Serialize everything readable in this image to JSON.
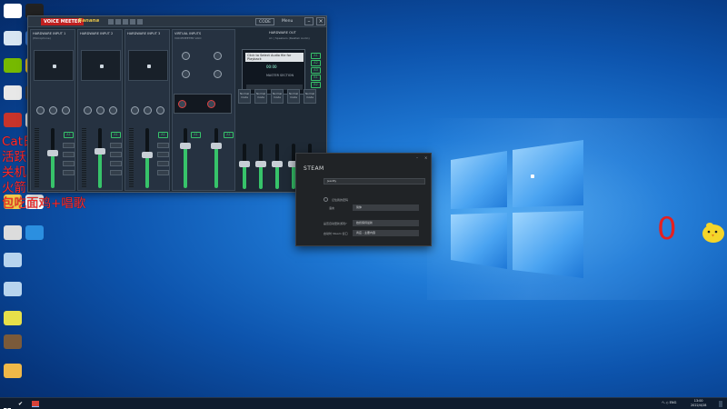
{
  "overlay": {
    "lines": [
      "Cat日常任务",
      "活跃0/66",
      "关机0/3",
      "火箭汽车0/1",
      "包吃面鸡+唱歌"
    ]
  },
  "counter": "0",
  "voicemeeter": {
    "brand": "VOICE MEETER",
    "edition": "Banana",
    "menu_button": "Menu",
    "record_button": "CODE",
    "strips": [
      {
        "title": "HARDWARE INPUT 1",
        "device": "(Microphone)",
        "label": "Fader Gain"
      },
      {
        "title": "HARDWARE INPUT 2",
        "device": "",
        "label": "Fader Gain"
      },
      {
        "title": "HARDWARE INPUT 3",
        "device": "",
        "label": "Fader Gain"
      },
      {
        "title": "VIRTUAL INPUTS",
        "device": "VOICEMEETER VAIO",
        "label": "Fader Gain"
      },
      {
        "title": "",
        "device": "VOICEMEETER AUX",
        "label": "Fader Gain"
      }
    ],
    "hw_out_title": "HARDWARE OUT",
    "hw_out_device": "A1 | Speakers (Realtek Audio)",
    "cassette_label": "Click to Select Audio file for Playback",
    "cassette_time": "00:00",
    "master_label": "MASTER SECTION",
    "bus_labels": [
      "Normal mode",
      "Normal mode",
      "Normal mode",
      "Normal mode",
      "Normal mode"
    ],
    "route_buttons": [
      "A1",
      "A2",
      "A3",
      "B1",
      "B2"
    ],
    "fader_fractions": [
      0.58,
      0.62,
      0.55,
      0.7,
      0.7,
      0.55,
      0.55,
      0.55,
      0.55,
      0.55
    ]
  },
  "steam": {
    "title": "STEAM",
    "account_field": "Jeanfly",
    "remember_label": "记住我的密码",
    "row1_label": "语言",
    "row1_value": "简体",
    "row2_label": "是否自动更新游戏?",
    "row2_value": "始终保持最新",
    "row3_label": "启动时 Steam 窗口",
    "row3_value": "商店 - 主要内容"
  },
  "taskbar": {
    "tray_text": "へ  ◇  ENG",
    "time": "13:00",
    "date": "2022/4/28"
  }
}
